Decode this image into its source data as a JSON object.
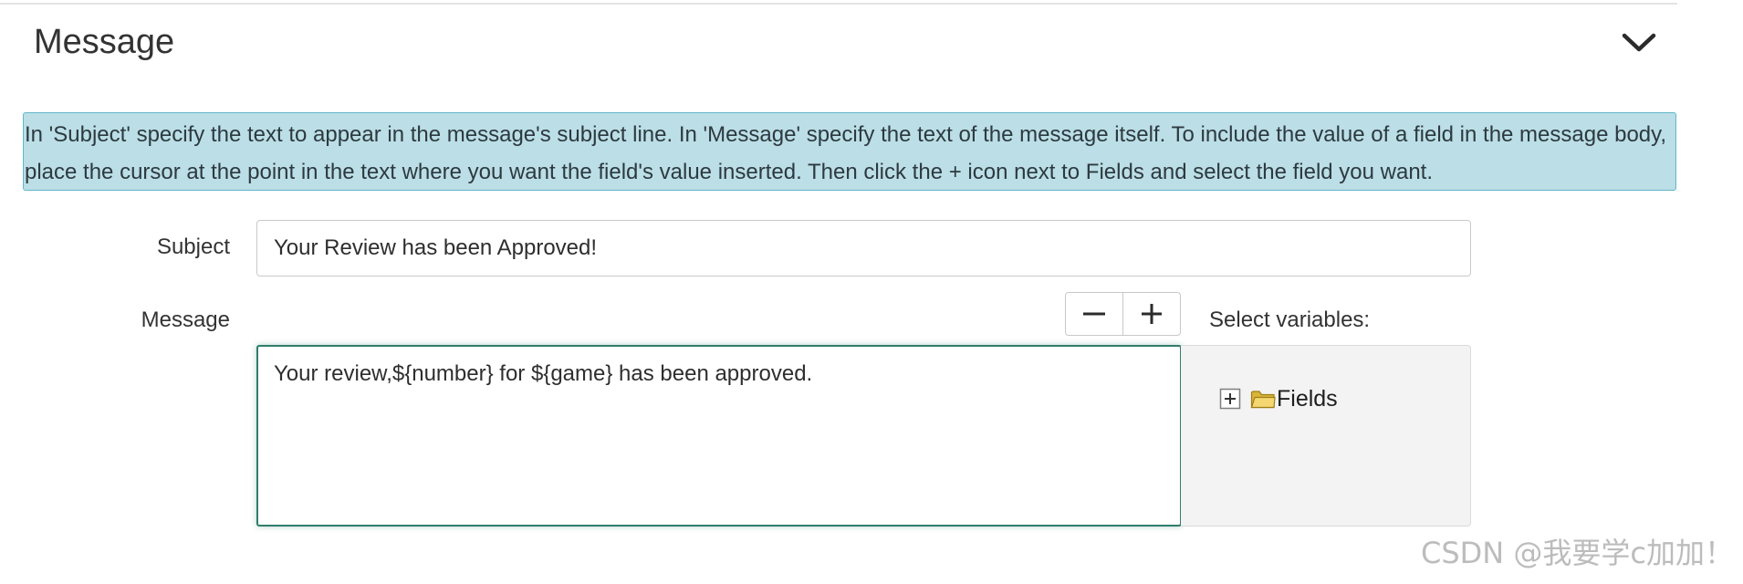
{
  "section": {
    "title": "Message",
    "toggle_icon": "chevron-down-icon"
  },
  "info": {
    "line1": "In 'Subject' specify the text to appear in the message's subject line. In 'Message' specify the text of the message itself. To include the value of a field in the message body,",
    "line2": "place the cursor at the point in the text where you want the field's value inserted. Then click the + icon next to Fields and select the field you want.",
    "background_color": "#bcdee6",
    "border_color": "#62b7cb"
  },
  "form": {
    "subject_label": "Subject",
    "subject_value": "Your Review has been Approved!",
    "message_label": "Message",
    "message_value": "Your review,${number} for ${game} has been approved.",
    "message_border_color": "#2f7d6c"
  },
  "size_controls": {
    "decrease_icon": "minus-icon",
    "increase_icon": "plus-icon"
  },
  "variables": {
    "label": "Select variables:",
    "tree": [
      {
        "label": "Fields",
        "expand_icon": "expand-plus-icon",
        "icon": "folder-icon"
      }
    ]
  },
  "watermark": "CSDN @我要学c加加！"
}
